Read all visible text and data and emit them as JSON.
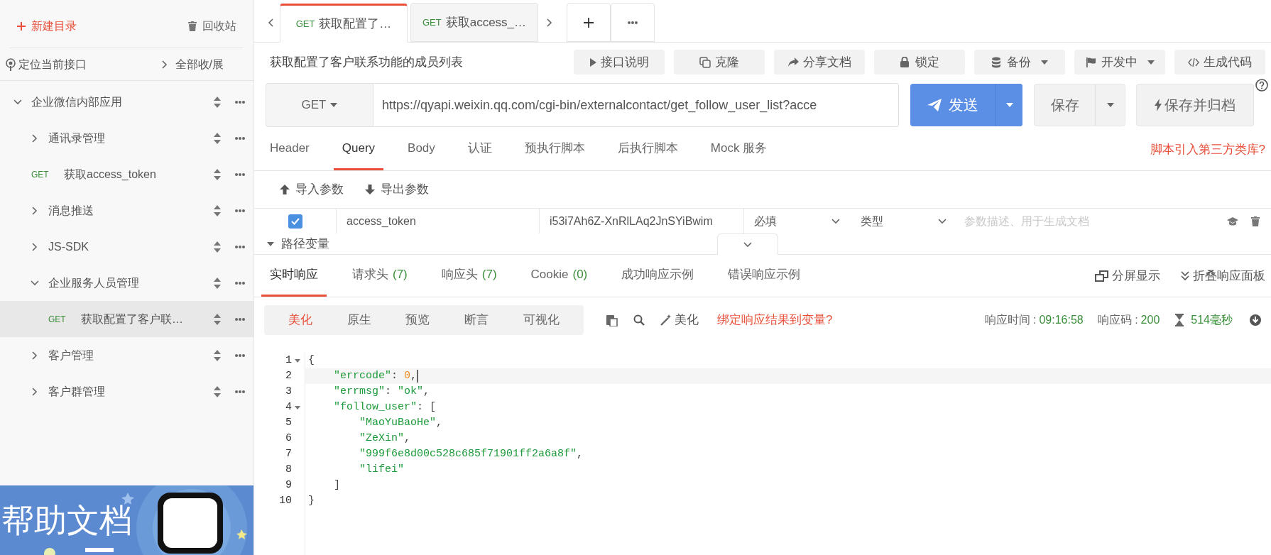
{
  "sidebar": {
    "new_folder": "新建目录",
    "trash": "回收站",
    "locate": "定位当前接口",
    "toggle_all": "全部收/展",
    "tree": [
      {
        "kind": "folder",
        "label": "企业微信内部应用",
        "expanded": true,
        "selected": false,
        "children": [
          {
            "kind": "folder",
            "label": "通讯录管理",
            "expanded": false,
            "selected": false
          },
          {
            "kind": "request",
            "method": "GET",
            "label": "获取access_token",
            "selected": false
          },
          {
            "kind": "folder",
            "label": "消息推送",
            "expanded": false,
            "selected": false
          },
          {
            "kind": "folder",
            "label": "JS-SDK",
            "expanded": false,
            "selected": false
          },
          {
            "kind": "folder",
            "label": "企业服务人员管理",
            "expanded": true,
            "selected": false,
            "children": [
              {
                "kind": "request",
                "method": "GET",
                "label": "获取配置了客户联…",
                "selected": true
              }
            ]
          },
          {
            "kind": "folder",
            "label": "客户管理",
            "expanded": false,
            "selected": false
          },
          {
            "kind": "folder",
            "label": "客户群管理",
            "expanded": false,
            "selected": false
          }
        ]
      }
    ],
    "banner": {
      "text": "帮助文档"
    }
  },
  "tabs": [
    {
      "method": "GET",
      "label": "获取配置了…",
      "selected": true
    },
    {
      "method": "GET",
      "label": "获取access_…",
      "selected": false
    }
  ],
  "request": {
    "title": "获取配置了客户联系功能的成员列表",
    "actions": [
      {
        "kind": "doc",
        "label": "接口说明",
        "dropdown": false
      },
      {
        "kind": "clone",
        "label": "克隆",
        "dropdown": false
      },
      {
        "kind": "share",
        "label": "分享文档",
        "dropdown": false
      },
      {
        "kind": "lock",
        "label": "锁定",
        "dropdown": false
      },
      {
        "kind": "backup",
        "label": "备份",
        "dropdown": true
      },
      {
        "kind": "status",
        "label": "开发中",
        "dropdown": true
      },
      {
        "kind": "code",
        "label": "生成代码",
        "dropdown": false
      }
    ],
    "method": "GET",
    "url": "https://qyapi.weixin.qq.com/cgi-bin/externalcontact/get_follow_user_list?acce",
    "send": "发送",
    "save": "保存",
    "save_archive": "保存并归档",
    "tabs": [
      {
        "label": "Header",
        "selected": false
      },
      {
        "label": "Query",
        "selected": true
      },
      {
        "label": "Body",
        "selected": false
      },
      {
        "label": "认证",
        "selected": false
      },
      {
        "label": "预执行脚本",
        "selected": false
      },
      {
        "label": "后执行脚本",
        "selected": false
      },
      {
        "label": "Mock 服务",
        "selected": false
      }
    ],
    "script_link": "脚本引入第三方类库?",
    "import_params": "导入参数",
    "export_params": "导出参数",
    "params": [
      {
        "checked": true,
        "name": "access_token",
        "value": "i53i7Ah6Z-XnRlLAq2JnSYiBwim",
        "required": "必填",
        "type": "类型",
        "description_placeholder": "参数描述、用于生成文档"
      }
    ],
    "path_variables": "路径变量"
  },
  "response": {
    "tabs": [
      {
        "label": "实时响应",
        "selected": true
      },
      {
        "label": "请求头",
        "count": "(7)",
        "selected": false
      },
      {
        "label": "响应头",
        "count": "(7)",
        "selected": false
      },
      {
        "label": "Cookie",
        "count": "(0)",
        "selected": false
      },
      {
        "label": "成功响应示例",
        "selected": false
      },
      {
        "label": "错误响应示例",
        "selected": false
      }
    ],
    "split_view": "分屏显示",
    "collapse_panel": "折叠响应面板",
    "views": [
      {
        "label": "美化",
        "selected": true
      },
      {
        "label": "原生",
        "selected": false
      },
      {
        "label": "预览",
        "selected": false
      },
      {
        "label": "断言",
        "selected": false
      },
      {
        "label": "可视化",
        "selected": false
      }
    ],
    "beautify": "美化",
    "bind_link": "绑定响应结果到变量?",
    "time_label": "响应时间 :",
    "time": "09:16:58",
    "code_label": "响应码 :",
    "code": "200",
    "duration": "514毫秒",
    "lines": [
      {
        "num": "1",
        "fold": true,
        "highlighted": false,
        "parts": [
          {
            "kind": "punct",
            "text": "{"
          }
        ]
      },
      {
        "num": "2",
        "fold": false,
        "highlighted": true,
        "parts": [
          {
            "kind": "string",
            "text": "    \"errcode\""
          },
          {
            "kind": "punct",
            "text": ": "
          },
          {
            "kind": "number",
            "text": "0"
          },
          {
            "kind": "punct",
            "text": ","
          }
        ]
      },
      {
        "num": "3",
        "fold": false,
        "highlighted": false,
        "parts": [
          {
            "kind": "string",
            "text": "    \"errmsg\""
          },
          {
            "kind": "punct",
            "text": ": "
          },
          {
            "kind": "string",
            "text": "\"ok\""
          },
          {
            "kind": "punct",
            "text": ","
          }
        ]
      },
      {
        "num": "4",
        "fold": true,
        "highlighted": false,
        "parts": [
          {
            "kind": "string",
            "text": "    \"follow_user\""
          },
          {
            "kind": "punct",
            "text": ": ["
          }
        ]
      },
      {
        "num": "5",
        "fold": false,
        "highlighted": false,
        "parts": [
          {
            "kind": "string",
            "text": "        \"MaoYuBaoHe\""
          },
          {
            "kind": "punct",
            "text": ","
          }
        ]
      },
      {
        "num": "6",
        "fold": false,
        "highlighted": false,
        "parts": [
          {
            "kind": "string",
            "text": "        \"ZeXin\""
          },
          {
            "kind": "punct",
            "text": ","
          }
        ]
      },
      {
        "num": "7",
        "fold": false,
        "highlighted": false,
        "parts": [
          {
            "kind": "string",
            "text": "        \"999f6e8d00c528c685f71901ff2a6a8f\""
          },
          {
            "kind": "punct",
            "text": ","
          }
        ]
      },
      {
        "num": "8",
        "fold": false,
        "highlighted": false,
        "parts": [
          {
            "kind": "string",
            "text": "        \"lifei\""
          }
        ]
      },
      {
        "num": "9",
        "fold": false,
        "highlighted": false,
        "parts": [
          {
            "kind": "punct",
            "text": "    ]"
          }
        ]
      },
      {
        "num": "10",
        "fold": false,
        "highlighted": false,
        "parts": [
          {
            "kind": "punct",
            "text": "}"
          }
        ]
      }
    ]
  }
}
